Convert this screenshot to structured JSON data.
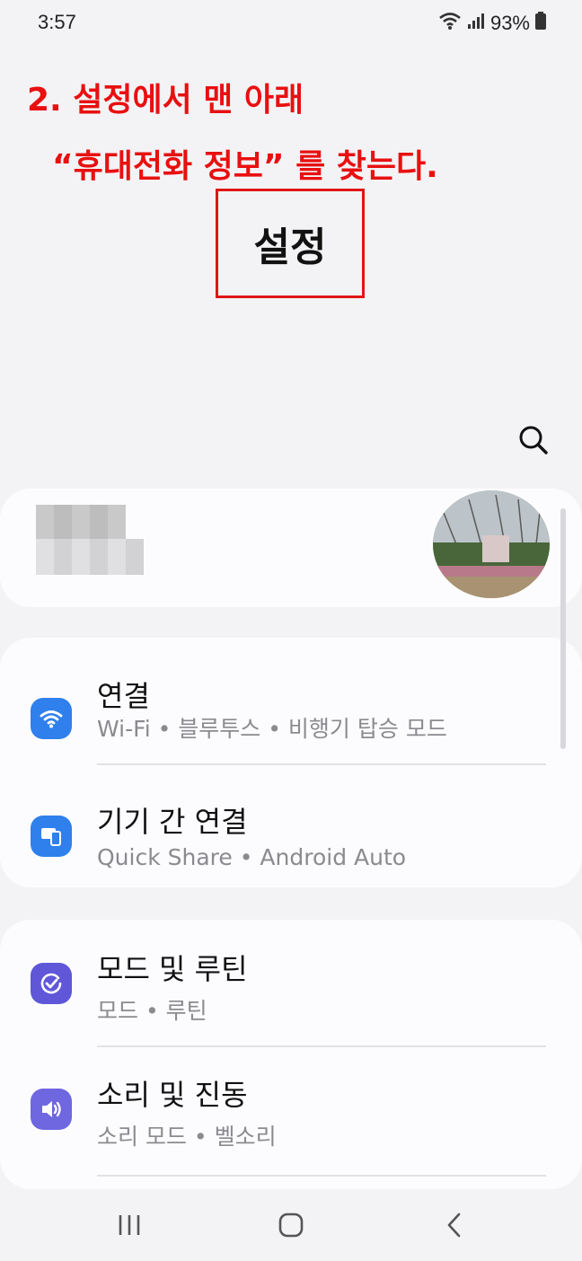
{
  "status": {
    "time": "3:57",
    "battery": "93%",
    "icons": [
      "wifi-icon",
      "signal-icon",
      "battery-icon"
    ]
  },
  "annotation": {
    "line1": "2. 설정에서 맨 아래",
    "line2": "“휴대전화 정보” 를 찾는다.",
    "color": "#e81010"
  },
  "header": {
    "title": "설정"
  },
  "list": {
    "connections": {
      "title": "연결",
      "subtitle": "Wi-Fi • 블루투스 • 비행기 탑승 모드",
      "icon": "wifi-icon",
      "color": "#2f80ed"
    },
    "device_connect": {
      "title": "기기 간 연결",
      "subtitle": "Quick Share • Android Auto",
      "icon": "devices-icon",
      "color": "#2f80ed"
    },
    "modes": {
      "title": "모드 및 루틴",
      "subtitle": "모드 • 루틴",
      "icon": "check-circle-icon",
      "color": "#5f57d8"
    },
    "sound": {
      "title": "소리 및 진동",
      "subtitle": "소리 모드 • 벨소리",
      "icon": "speaker-icon",
      "color": "#6f67e0"
    }
  },
  "nav": {
    "recents": "recents-icon",
    "home": "home-icon",
    "back": "back-icon"
  }
}
